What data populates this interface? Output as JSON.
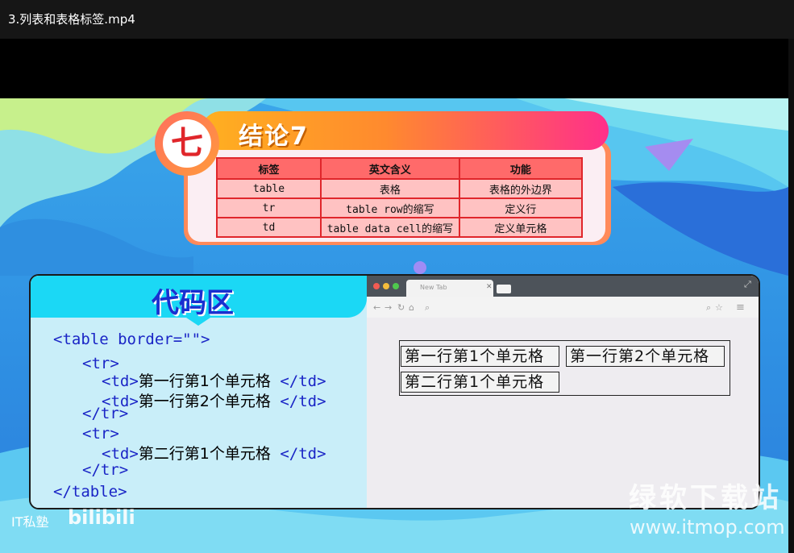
{
  "window": {
    "title": "3.列表和表格标签.mp4"
  },
  "colors": {
    "accent_red": "#e0262b",
    "code_blue": "#1a25c6",
    "banner_orange": "#ff8a2e",
    "banner_pink": "#ff2f8a"
  },
  "conclusion": {
    "badge": "七",
    "title": "结论7",
    "table": {
      "headers": [
        "标签",
        "英文含义",
        "功能"
      ],
      "rows": [
        [
          "table",
          "表格",
          "表格的外边界"
        ],
        [
          "tr",
          "table row的缩写",
          "定义行"
        ],
        [
          "td",
          "table data cell的缩写",
          "定义单元格"
        ]
      ]
    }
  },
  "code": {
    "title": "代码区",
    "lines": [
      {
        "tag": "<table border=\"\">"
      },
      {
        "tag": "<tr>"
      },
      {
        "open": "<td>",
        "text": "第一行第1个单元格",
        "close": "</td>"
      },
      {
        "open": "<td>",
        "text": "第一行第2个单元格",
        "close": "</td>"
      },
      {
        "tag": "</tr>"
      },
      {
        "tag": "<tr>"
      },
      {
        "open": "<td>",
        "text": "第二行第1个单元格",
        "close": "</td>"
      },
      {
        "tag": "</tr>"
      },
      {
        "tag": "</table>"
      }
    ]
  },
  "browser": {
    "tab_label": "New Tab",
    "icons": [
      "close-tab-icon",
      "back-icon",
      "forward-icon",
      "reload-icon",
      "home-icon",
      "search-icon",
      "zoom-icon",
      "star-icon",
      "menu-icon",
      "maximize-icon"
    ],
    "cells": [
      "第一行第1个单元格",
      "第一行第2个单元格",
      "第二行第1个单元格"
    ]
  },
  "watermarks": {
    "left_text": "IT私塾",
    "left_logo": "bilibili",
    "site_name": "绿软下载站",
    "site_url": "www.itmop.com"
  }
}
